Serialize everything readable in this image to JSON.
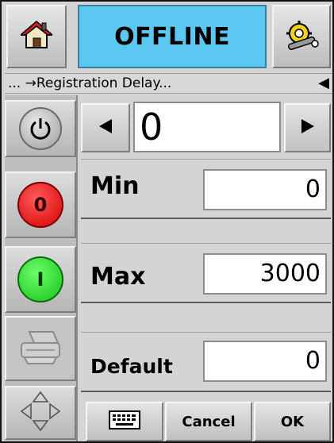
{
  "header": {
    "status": "OFFLINE",
    "home_icon": "home-icon",
    "settings_icon": "settings-wrench-icon"
  },
  "breadcrumb": {
    "path": "... →Registration Delay...",
    "back_glyph": "◀"
  },
  "sidebar": {
    "power_icon": "power-icon",
    "stop_label": "0",
    "start_label": "I",
    "print_icon": "printer-icon",
    "nav_icon": "directional-arrows-icon"
  },
  "editor": {
    "value": "0",
    "decrement_glyph": "◂",
    "increment_glyph": "▸"
  },
  "params": {
    "min_label": "Min",
    "min_value": "0",
    "max_label": "Max",
    "max_value": "3000",
    "default_label": "Default",
    "default_value": "0"
  },
  "toolbar": {
    "keyboard_icon": "keyboard-icon",
    "cancel_label": "Cancel",
    "ok_label": "OK"
  },
  "colors": {
    "status_bg": "#5cc8f2",
    "stop": "#e00000",
    "start": "#22d022"
  }
}
